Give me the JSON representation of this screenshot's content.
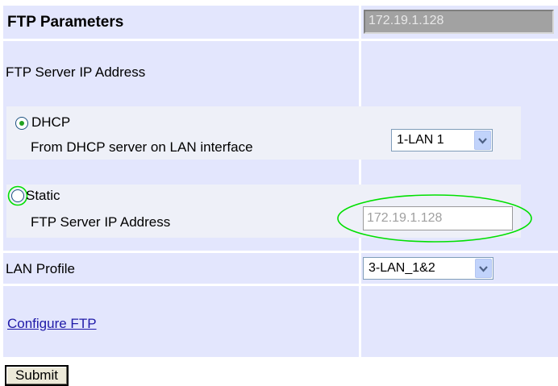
{
  "header": {
    "title": "FTP Parameters",
    "current_ip": "172.19.1.128"
  },
  "server_ip": {
    "section_label": "FTP Server IP Address",
    "dhcp": {
      "label": "DHCP",
      "description": "From DHCP server on LAN interface",
      "selected": true,
      "interface_select": {
        "value": "1-LAN 1"
      }
    },
    "static": {
      "label": "Static",
      "field_label": "FTP Server IP Address",
      "selected": false,
      "value": "172.19.1.128"
    }
  },
  "lan_profile": {
    "label": "LAN Profile",
    "value": "3-LAN_1&2"
  },
  "configure_link": "Configure FTP",
  "submit_label": "Submit",
  "colors": {
    "cell_background": "#e3e6fd",
    "highlight_annotation": "#00e000",
    "link": "#1f1aa8"
  }
}
